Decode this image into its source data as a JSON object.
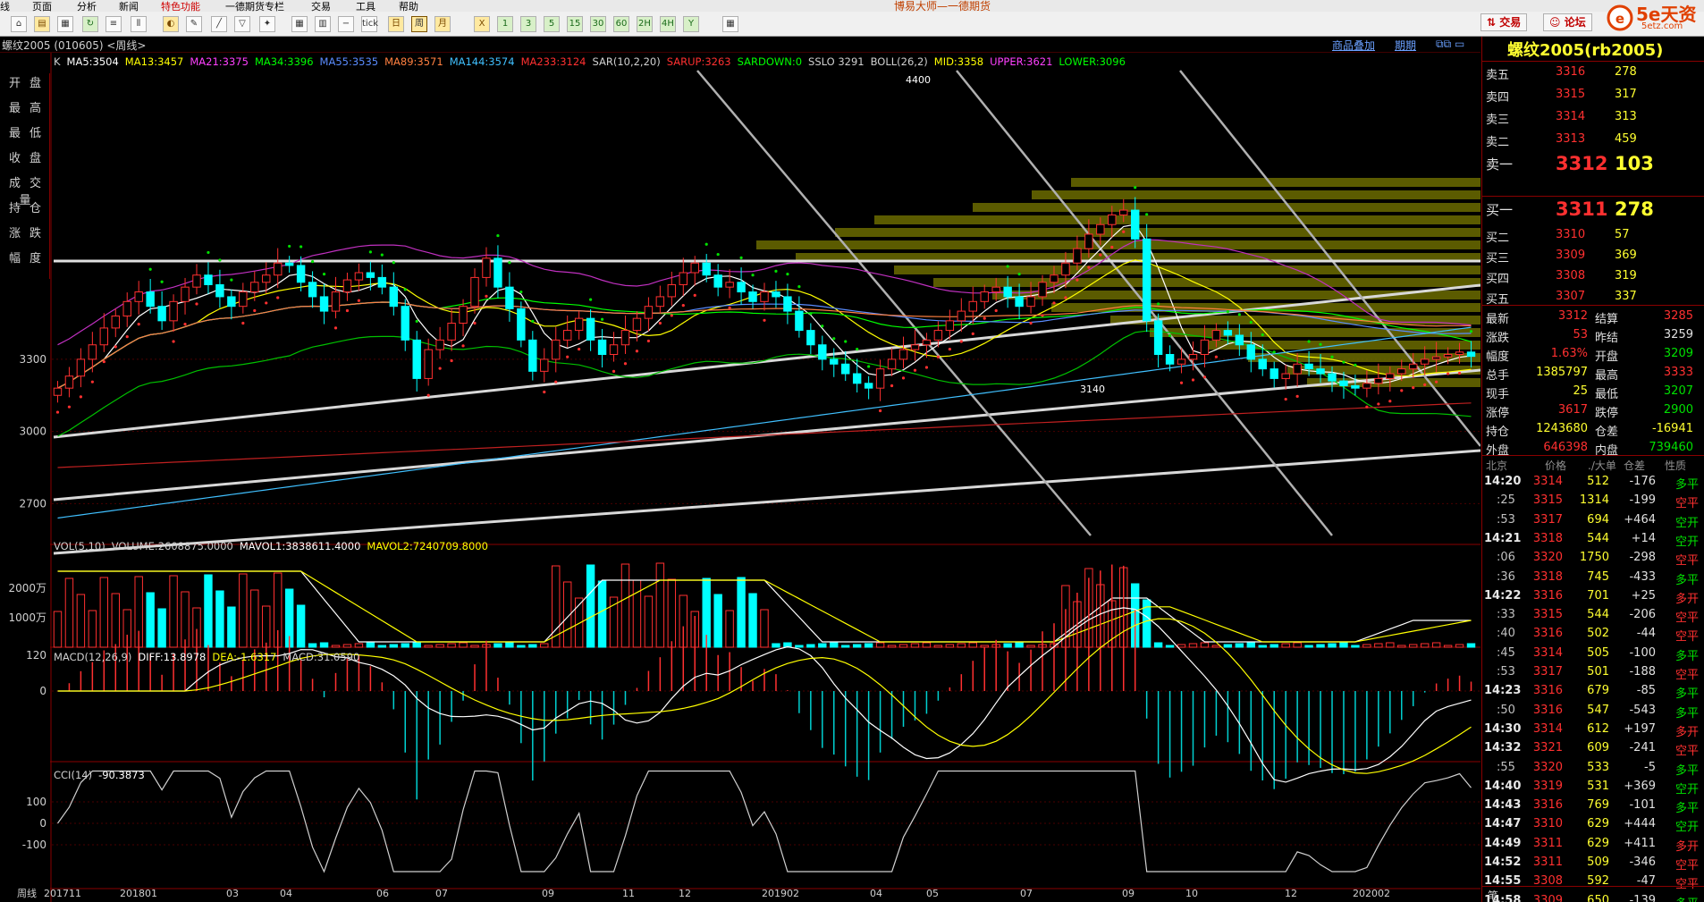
{
  "menu": {
    "items": [
      "线",
      "页面",
      "分析",
      "新闻",
      "特色功能",
      "一德期货专栏",
      "交易",
      "工具",
      "帮助"
    ],
    "center_title": "博易大师—一德期货",
    "trade_button": "交易",
    "forum_button": "论坛"
  },
  "logo": {
    "name": "5e天资",
    "sub": "5etz.com"
  },
  "toolbar": {
    "period_buttons": [
      "tick",
      "日",
      "周",
      "月",
      "X",
      "1",
      "3",
      "5",
      "15",
      "30",
      "60",
      "2H",
      "4H",
      "Y"
    ],
    "selected_period": "周"
  },
  "strip": {
    "instrument": "螺纹2005 (010605) <周线>",
    "right_links": [
      "商品叠加",
      "期期"
    ]
  },
  "main_indicators": [
    {
      "label": "K",
      "color": "#d0d0d0"
    },
    {
      "label": "MA5:3504",
      "color": "#ffffff"
    },
    {
      "label": "MA13:3457",
      "color": "#ffff00"
    },
    {
      "label": "MA21:3375",
      "color": "#ff40ff"
    },
    {
      "label": "MA34:3396",
      "color": "#00ff00"
    },
    {
      "label": "MA55:3535",
      "color": "#5a8cff"
    },
    {
      "label": "MA89:3571",
      "color": "#ff8040"
    },
    {
      "label": "MA144:3574",
      "color": "#40c0ff"
    },
    {
      "label": "MA233:3124",
      "color": "#ff3030"
    },
    {
      "label": "SAR(10,2,20)",
      "color": "#d0d0d0"
    },
    {
      "label": "SARUP:3263",
      "color": "#ff3030"
    },
    {
      "label": "SARDOWN:0",
      "color": "#00ff00"
    },
    {
      "label": "SSLO 3291",
      "color": "#d0d0d0"
    },
    {
      "label": "BOLL(26,2)",
      "color": "#d0d0d0"
    },
    {
      "label": "MID:3358",
      "color": "#ffff00"
    },
    {
      "label": "UPPER:3621",
      "color": "#ff40ff"
    },
    {
      "label": "LOWER:3096",
      "color": "#00ff00"
    }
  ],
  "left_buttons": [
    "开盘",
    "最高",
    "最低",
    "收盘",
    "成交量",
    "持仓",
    "涨跌",
    "幅度"
  ],
  "price_axis": [
    "3300",
    "3000",
    "2700"
  ],
  "price_annotations": {
    "high": "4400",
    "low": "3140"
  },
  "vol_header": [
    {
      "label": "VOL(5,10)",
      "color": "#d0d0d0"
    },
    {
      "label": "VOLUME:2608875.0000",
      "color": "#d0d0d0"
    },
    {
      "label": "MAVOL1:3838611.4000",
      "color": "#ffffff"
    },
    {
      "label": "MAVOL2:7240709.8000",
      "color": "#ffff00"
    }
  ],
  "vol_axis": [
    "2000万",
    "1000万"
  ],
  "macd_header": [
    {
      "label": "MACD(12,26,9)",
      "color": "#d0d0d0"
    },
    {
      "label": "DIFF:13.8978",
      "color": "#ffffff"
    },
    {
      "label": "DEA:-1.6317",
      "color": "#ffff00"
    },
    {
      "label": "MACD:31.0590",
      "color": "#d0d0d0"
    }
  ],
  "macd_axis": [
    "120",
    "0"
  ],
  "cci_header": [
    {
      "label": "CCI(14)",
      "color": "#d0d0d0"
    },
    {
      "label": "-90.3873",
      "color": "#ffffff"
    }
  ],
  "cci_axis": [
    "100",
    "0",
    "-100"
  ],
  "date_axis": [
    "周线",
    "201711",
    "201801",
    "03",
    "04",
    "06",
    "07",
    "09",
    "11",
    "12",
    "201902",
    "04",
    "05",
    "07",
    "09",
    "10",
    "12",
    "202002"
  ],
  "quote": {
    "title": "螺纹2005(rb2005)",
    "asks": [
      {
        "label": "卖五",
        "price": "3316",
        "vol": "278"
      },
      {
        "label": "卖四",
        "price": "3315",
        "vol": "317"
      },
      {
        "label": "卖三",
        "price": "3314",
        "vol": "313"
      },
      {
        "label": "卖二",
        "price": "3313",
        "vol": "459"
      },
      {
        "label": "卖一",
        "price": "3312",
        "vol": "103"
      }
    ],
    "bids": [
      {
        "label": "买一",
        "price": "3311",
        "vol": "278"
      },
      {
        "label": "买二",
        "price": "3310",
        "vol": "57"
      },
      {
        "label": "买三",
        "price": "3309",
        "vol": "369"
      },
      {
        "label": "买四",
        "price": "3308",
        "vol": "319"
      },
      {
        "label": "买五",
        "price": "3307",
        "vol": "337"
      }
    ],
    "stats": [
      {
        "l1": "最新",
        "v1": "3312",
        "c1": "red",
        "l2": "结算",
        "v2": "3285",
        "c2": "red"
      },
      {
        "l1": "涨跌",
        "v1": "53",
        "c1": "red",
        "l2": "昨结",
        "v2": "3259",
        "c2": "wht"
      },
      {
        "l1": "幅度",
        "v1": "1.63%",
        "c1": "red",
        "l2": "开盘",
        "v2": "3209",
        "c2": "grn"
      },
      {
        "l1": "总手",
        "v1": "1385797",
        "c1": "yel",
        "l2": "最高",
        "v2": "3333",
        "c2": "red"
      },
      {
        "l1": "现手",
        "v1": "25",
        "c1": "yel",
        "l2": "最低",
        "v2": "3207",
        "c2": "grn"
      },
      {
        "l1": "涨停",
        "v1": "3617",
        "c1": "red",
        "l2": "跌停",
        "v2": "2900",
        "c2": "grn"
      },
      {
        "l1": "持仓",
        "v1": "1243680",
        "c1": "yel",
        "l2": "仓差",
        "v2": "-16941",
        "c2": "yel"
      },
      {
        "l1": "外盘",
        "v1": "646398",
        "c1": "red",
        "l2": "内盘",
        "v2": "739460",
        "c2": "grn"
      }
    ],
    "tick_header": [
      "北京",
      "价格",
      "./大单",
      "仓差",
      "性质"
    ],
    "ticks": [
      {
        "t": "14:20",
        "p": "3314",
        "pc": "red",
        "v": "512",
        "d": "-176",
        "n": "多平",
        "nc": "grn"
      },
      {
        "t": ":25",
        "p": "3315",
        "pc": "red",
        "v": "1314",
        "d": "-199",
        "n": "空平",
        "nc": "red"
      },
      {
        "t": ":53",
        "p": "3317",
        "pc": "red",
        "v": "694",
        "d": "+464",
        "n": "空开",
        "nc": "grn"
      },
      {
        "t": "14:21",
        "p": "3318",
        "pc": "red",
        "v": "544",
        "d": "+14",
        "n": "空开",
        "nc": "grn"
      },
      {
        "t": ":06",
        "p": "3320",
        "pc": "red",
        "v": "1750",
        "d": "-298",
        "n": "空平",
        "nc": "red"
      },
      {
        "t": ":36",
        "p": "3318",
        "pc": "red",
        "v": "745",
        "d": "-433",
        "n": "多平",
        "nc": "grn"
      },
      {
        "t": "14:22",
        "p": "3316",
        "pc": "red",
        "v": "701",
        "d": "+25",
        "n": "多开",
        "nc": "red"
      },
      {
        "t": ":33",
        "p": "3315",
        "pc": "red",
        "v": "544",
        "d": "-206",
        "n": "空平",
        "nc": "red"
      },
      {
        "t": ":40",
        "p": "3316",
        "pc": "red",
        "v": "502",
        "d": "-44",
        "n": "空平",
        "nc": "red"
      },
      {
        "t": ":45",
        "p": "3314",
        "pc": "red",
        "v": "505",
        "d": "-100",
        "n": "多平",
        "nc": "grn"
      },
      {
        "t": ":53",
        "p": "3317",
        "pc": "red",
        "v": "501",
        "d": "-188",
        "n": "空平",
        "nc": "red"
      },
      {
        "t": "14:23",
        "p": "3316",
        "pc": "red",
        "v": "679",
        "d": "-85",
        "n": "多平",
        "nc": "grn"
      },
      {
        "t": ":50",
        "p": "3316",
        "pc": "red",
        "v": "547",
        "d": "-543",
        "n": "多平",
        "nc": "grn"
      },
      {
        "t": "14:30",
        "p": "3314",
        "pc": "red",
        "v": "612",
        "d": "+197",
        "n": "多开",
        "nc": "red"
      },
      {
        "t": "14:32",
        "p": "3321",
        "pc": "red",
        "v": "609",
        "d": "-241",
        "n": "空平",
        "nc": "red"
      },
      {
        "t": ":55",
        "p": "3320",
        "pc": "red",
        "v": "533",
        "d": "-5",
        "n": "多平",
        "nc": "grn"
      },
      {
        "t": "14:40",
        "p": "3319",
        "pc": "red",
        "v": "531",
        "d": "+369",
        "n": "空开",
        "nc": "grn"
      },
      {
        "t": "14:43",
        "p": "3316",
        "pc": "red",
        "v": "769",
        "d": "-101",
        "n": "多平",
        "nc": "grn"
      },
      {
        "t": "14:47",
        "p": "3310",
        "pc": "red",
        "v": "629",
        "d": "+444",
        "n": "空开",
        "nc": "grn"
      },
      {
        "t": "14:49",
        "p": "3311",
        "pc": "red",
        "v": "629",
        "d": "+411",
        "n": "多开",
        "nc": "red"
      },
      {
        "t": "14:52",
        "p": "3311",
        "pc": "red",
        "v": "509",
        "d": "-346",
        "n": "空平",
        "nc": "red"
      },
      {
        "t": "14:55",
        "p": "3308",
        "pc": "red",
        "v": "592",
        "d": "-47",
        "n": "空平",
        "nc": "red"
      },
      {
        "t": "14:58",
        "p": "3309",
        "pc": "red",
        "v": "650",
        "d": "-139",
        "n": "多平",
        "nc": "grn"
      }
    ],
    "footer_tab": "笔"
  },
  "chart_data": {
    "type": "candlestick",
    "period": "weekly",
    "price_range": [
      2560,
      4500
    ],
    "closes": [
      3180,
      3230,
      3300,
      3360,
      3430,
      3480,
      3540,
      3580,
      3520,
      3460,
      3540,
      3600,
      3650,
      3610,
      3560,
      3520,
      3580,
      3620,
      3650,
      3700,
      3690,
      3620,
      3560,
      3500,
      3580,
      3630,
      3660,
      3640,
      3600,
      3520,
      3380,
      3220,
      3340,
      3380,
      3450,
      3520,
      3640,
      3720,
      3600,
      3510,
      3380,
      3250,
      3300,
      3380,
      3420,
      3470,
      3380,
      3320,
      3360,
      3420,
      3470,
      3520,
      3560,
      3610,
      3660,
      3700,
      3650,
      3600,
      3620,
      3580,
      3540,
      3580,
      3560,
      3500,
      3420,
      3360,
      3300,
      3280,
      3240,
      3200,
      3180,
      3260,
      3300,
      3340,
      3360,
      3380,
      3420,
      3460,
      3500,
      3540,
      3580,
      3600,
      3560,
      3520,
      3560,
      3620,
      3650,
      3700,
      3760,
      3820,
      3860,
      3900,
      3920,
      3800,
      3460,
      3320,
      3280,
      3300,
      3320,
      3380,
      3420,
      3400,
      3360,
      3300,
      3260,
      3220,
      3240,
      3280,
      3260,
      3240,
      3210,
      3190,
      3180,
      3200,
      3220,
      3240,
      3260,
      3280,
      3300,
      3310,
      3320,
      3330,
      3312
    ]
  }
}
